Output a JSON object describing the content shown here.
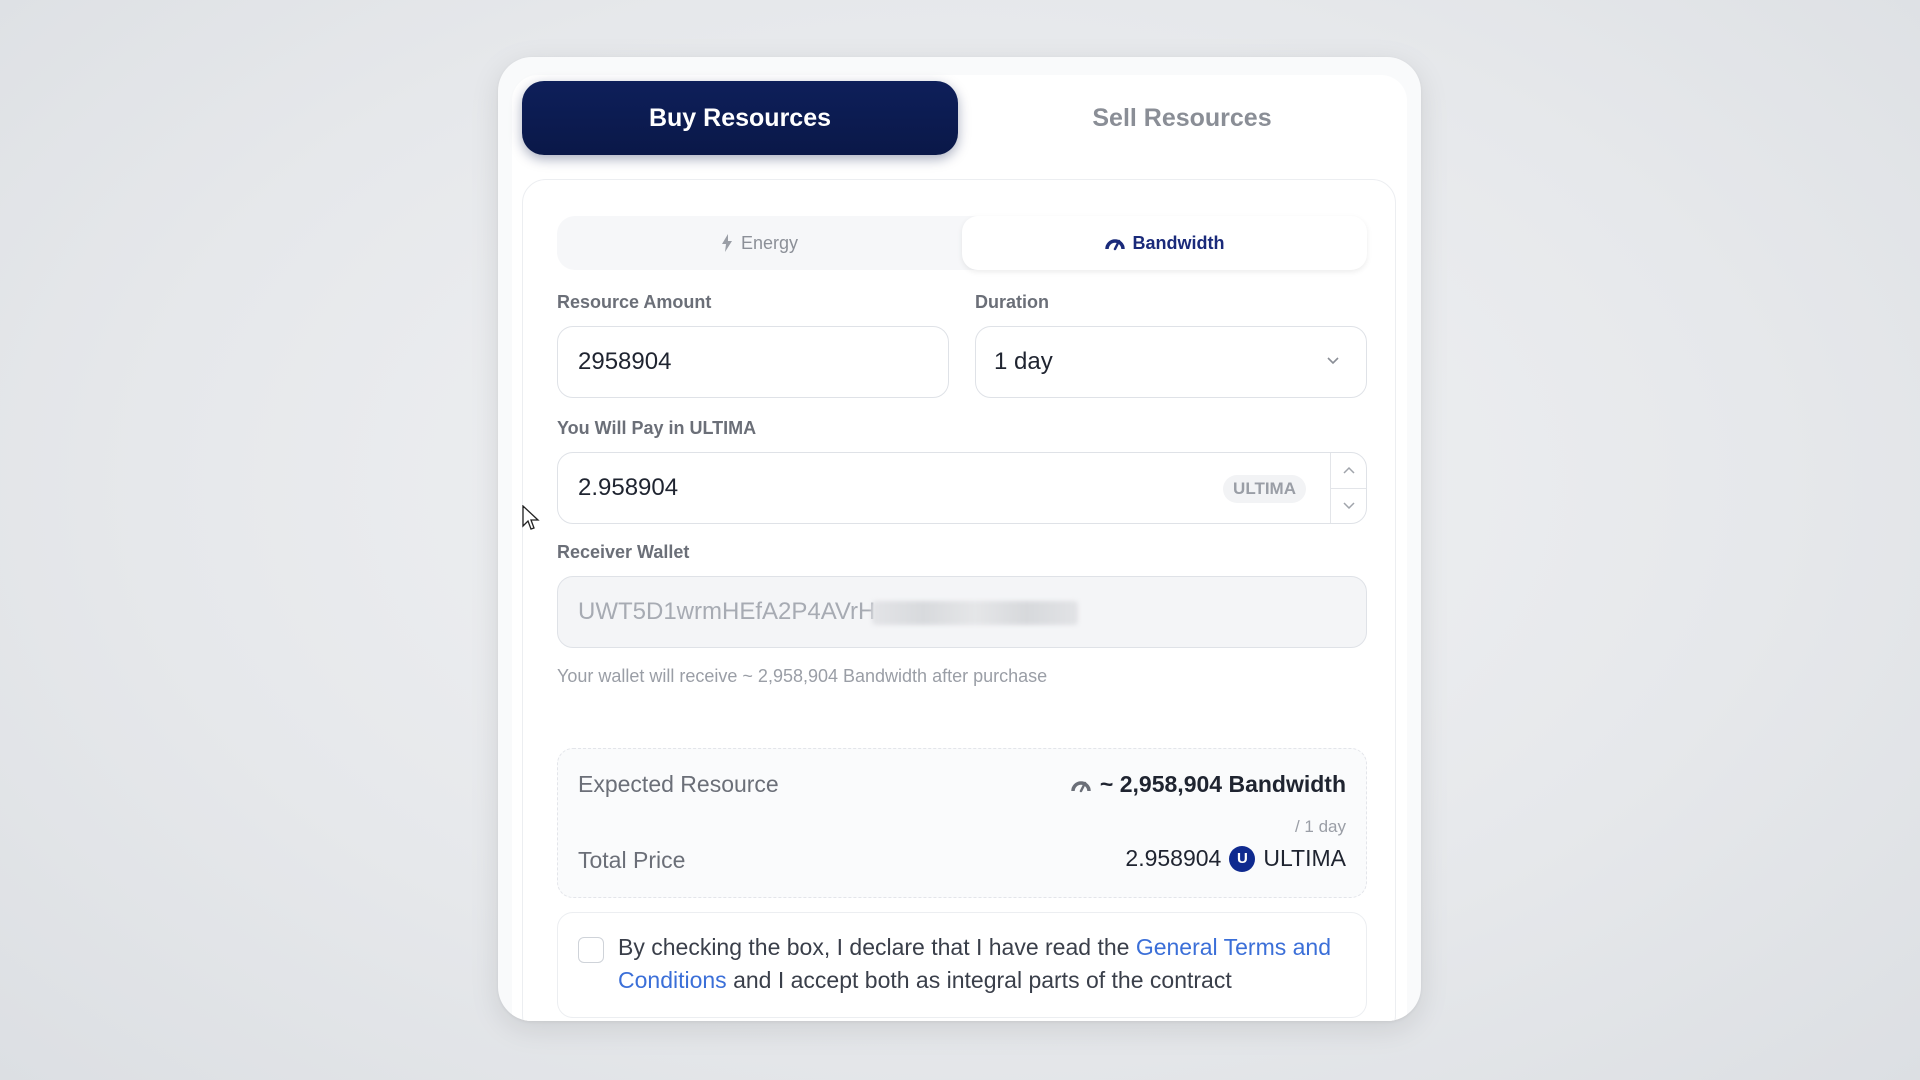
{
  "tabs": {
    "buy": "Buy Resources",
    "sell": "Sell Resources"
  },
  "resource_tabs": {
    "energy": "Energy",
    "bandwidth": "Bandwidth",
    "selected": "Bandwidth"
  },
  "form": {
    "amount_label": "Resource Amount",
    "amount_value": "2958904",
    "duration_label": "Duration",
    "duration_value": "1 day",
    "pay_label": "You Will Pay in ULTIMA",
    "pay_value": "2.958904",
    "pay_unit": "ULTIMA",
    "wallet_label": "Receiver Wallet",
    "wallet_value": "UWT5D1wrmHEfA2P4AVrH",
    "wallet_hint": "Your wallet will receive ~ 2,958,904 Bandwidth after purchase"
  },
  "summary": {
    "expected_label": "Expected Resource",
    "expected_value": "~ 2,958,904 Bandwidth",
    "expected_duration": "/ 1 day",
    "price_label": "Total Price",
    "price_value": "2.958904",
    "price_coin_symbol": "U",
    "price_unit": "ULTIMA"
  },
  "terms": {
    "text_before": "By checking the box, I declare that I have read the ",
    "link": "General Terms and Conditions",
    "text_after": " and I accept both as integral parts of the contract",
    "checked": false
  },
  "colors": {
    "primary": "#0e1f5a",
    "link": "#3b6fd8",
    "coin": "#0f2a8f"
  }
}
